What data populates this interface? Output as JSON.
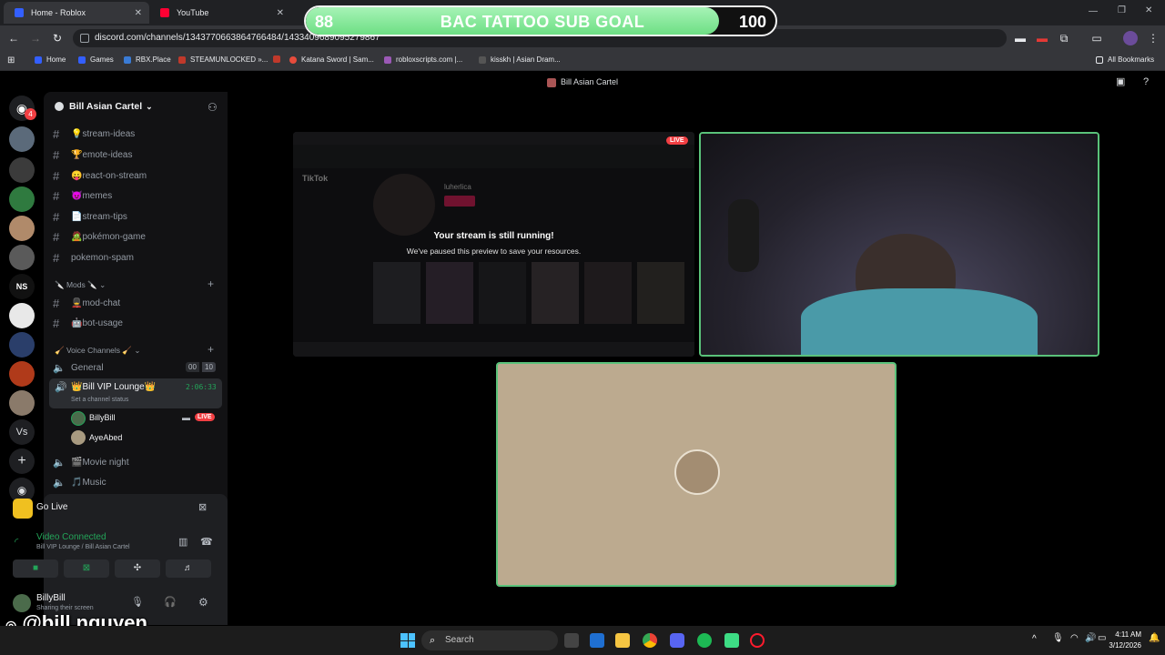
{
  "browser": {
    "tabs": [
      {
        "label": "Home - Roblox",
        "icon": "roblox-icon",
        "color": "#335fff"
      },
      {
        "label": "YouTube",
        "icon": "youtube-icon",
        "color": "#ff0033"
      }
    ],
    "url": "discord.com/channels/1343770663864766484/1433409689095279867",
    "bookmarks": [
      {
        "label": "Home",
        "color": "#335fff"
      },
      {
        "label": "Games",
        "color": "#335fff"
      },
      {
        "label": "RBX.Place",
        "color": "#3a7bd5"
      },
      {
        "label": "STEAMUNLOCKED »...",
        "color": "#c0392b"
      },
      {
        "label": "",
        "color": "#c0392b"
      },
      {
        "label": "Katana Sword | Sam...",
        "color": "#e74c3c"
      },
      {
        "label": "robloxscripts.com |...",
        "color": "#9b59b6"
      },
      {
        "label": "kisskh | Asian Dram...",
        "color": "#555"
      }
    ],
    "all_bookmarks": "All Bookmarks"
  },
  "sub_goal": {
    "current": "88",
    "title": "BAC TATTOO SUB GOAL",
    "target": "100",
    "progress": 0.88
  },
  "discord": {
    "window_title": "Bill Asian Cartel",
    "server_name": "Bill Asian Cartel",
    "notification_badge": "4",
    "channels": [
      {
        "emoji": "💡",
        "name": "stream-ideas"
      },
      {
        "emoji": "🏆",
        "name": "emote-ideas"
      },
      {
        "emoji": "😛",
        "name": "react-on-stream"
      },
      {
        "emoji": "😈",
        "name": "memes"
      },
      {
        "emoji": "📄",
        "name": "stream-tips"
      },
      {
        "emoji": "🧟",
        "name": "pokémon-game"
      },
      {
        "emoji": "",
        "name": "pokemon-spam"
      }
    ],
    "mods_category": "Mods",
    "mod_channels": [
      {
        "emoji": "💂",
        "name": "mod-chat"
      },
      {
        "emoji": "🤖",
        "name": "bot-usage"
      }
    ],
    "voice_category": "Voice Channels",
    "voice": {
      "general": {
        "name": "General",
        "count_a": "00",
        "count_b": "10"
      },
      "vip": {
        "name": "Bill VIP Lounge",
        "timer": "2:06:33",
        "status": "Set a channel status"
      },
      "members": [
        {
          "name": "BillyBill",
          "live": "LIVE"
        },
        {
          "name": "AyeAbed"
        }
      ],
      "movie": {
        "name": "Movie night"
      },
      "music": {
        "name": "Music"
      }
    },
    "panel": {
      "go_live": "Go Live",
      "video_connected": "Video Connected",
      "location": "Bill VIP Lounge / Bill Asian Cartel",
      "user": "BillyBill",
      "user_status": "Sharing their screen"
    },
    "stage": {
      "live_badge": "LIVE",
      "paused_title": "Your stream is still running!",
      "paused_sub": "We've paused this preview to save your resources.",
      "preview_profile": "luherlica",
      "preview_app": "TikTok"
    }
  },
  "taskbar": {
    "search": "Search",
    "time": "4:11 AM",
    "date": "3/12/2026"
  },
  "watermark": "@bill.nguyen"
}
